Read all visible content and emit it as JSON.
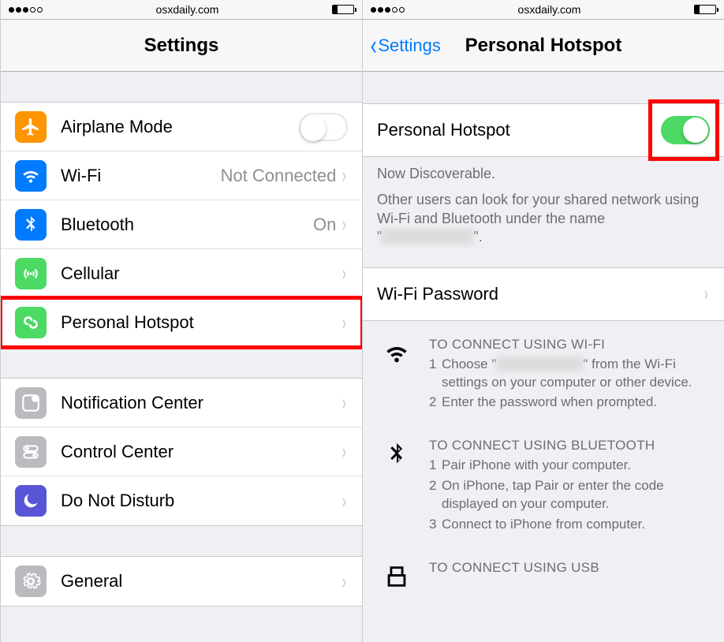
{
  "status": {
    "domain": "osxdaily.com"
  },
  "left": {
    "title": "Settings",
    "rows": {
      "airplane": {
        "label": "Airplane Mode"
      },
      "wifi": {
        "label": "Wi-Fi",
        "detail": "Not Connected"
      },
      "bluetooth": {
        "label": "Bluetooth",
        "detail": "On"
      },
      "cellular": {
        "label": "Cellular"
      },
      "hotspot": {
        "label": "Personal Hotspot"
      },
      "notif": {
        "label": "Notification Center"
      },
      "cc": {
        "label": "Control Center"
      },
      "dnd": {
        "label": "Do Not Disturb"
      },
      "general": {
        "label": "General"
      }
    }
  },
  "right": {
    "back": "Settings",
    "title": "Personal Hotspot",
    "toggle": {
      "label": "Personal Hotspot",
      "on": true
    },
    "desc1": "Now Discoverable.",
    "desc2a": "Other users can look for your shared network using Wi-Fi and Bluetooth under the name \"",
    "desc2b": "\".",
    "wifipw": {
      "label": "Wi-Fi Password"
    },
    "wifi": {
      "title": "TO CONNECT USING WI-FI",
      "step1a": "Choose \"",
      "step1b": "\" from the Wi-Fi settings on your computer or other device.",
      "step2": "Enter the password when prompted."
    },
    "bt": {
      "title": "TO CONNECT USING BLUETOOTH",
      "step1": "Pair iPhone with your computer.",
      "step2": "On iPhone, tap Pair or enter the code displayed on your computer.",
      "step3": "Connect to iPhone from computer."
    },
    "usb": {
      "title": "TO CONNECT USING USB"
    }
  }
}
